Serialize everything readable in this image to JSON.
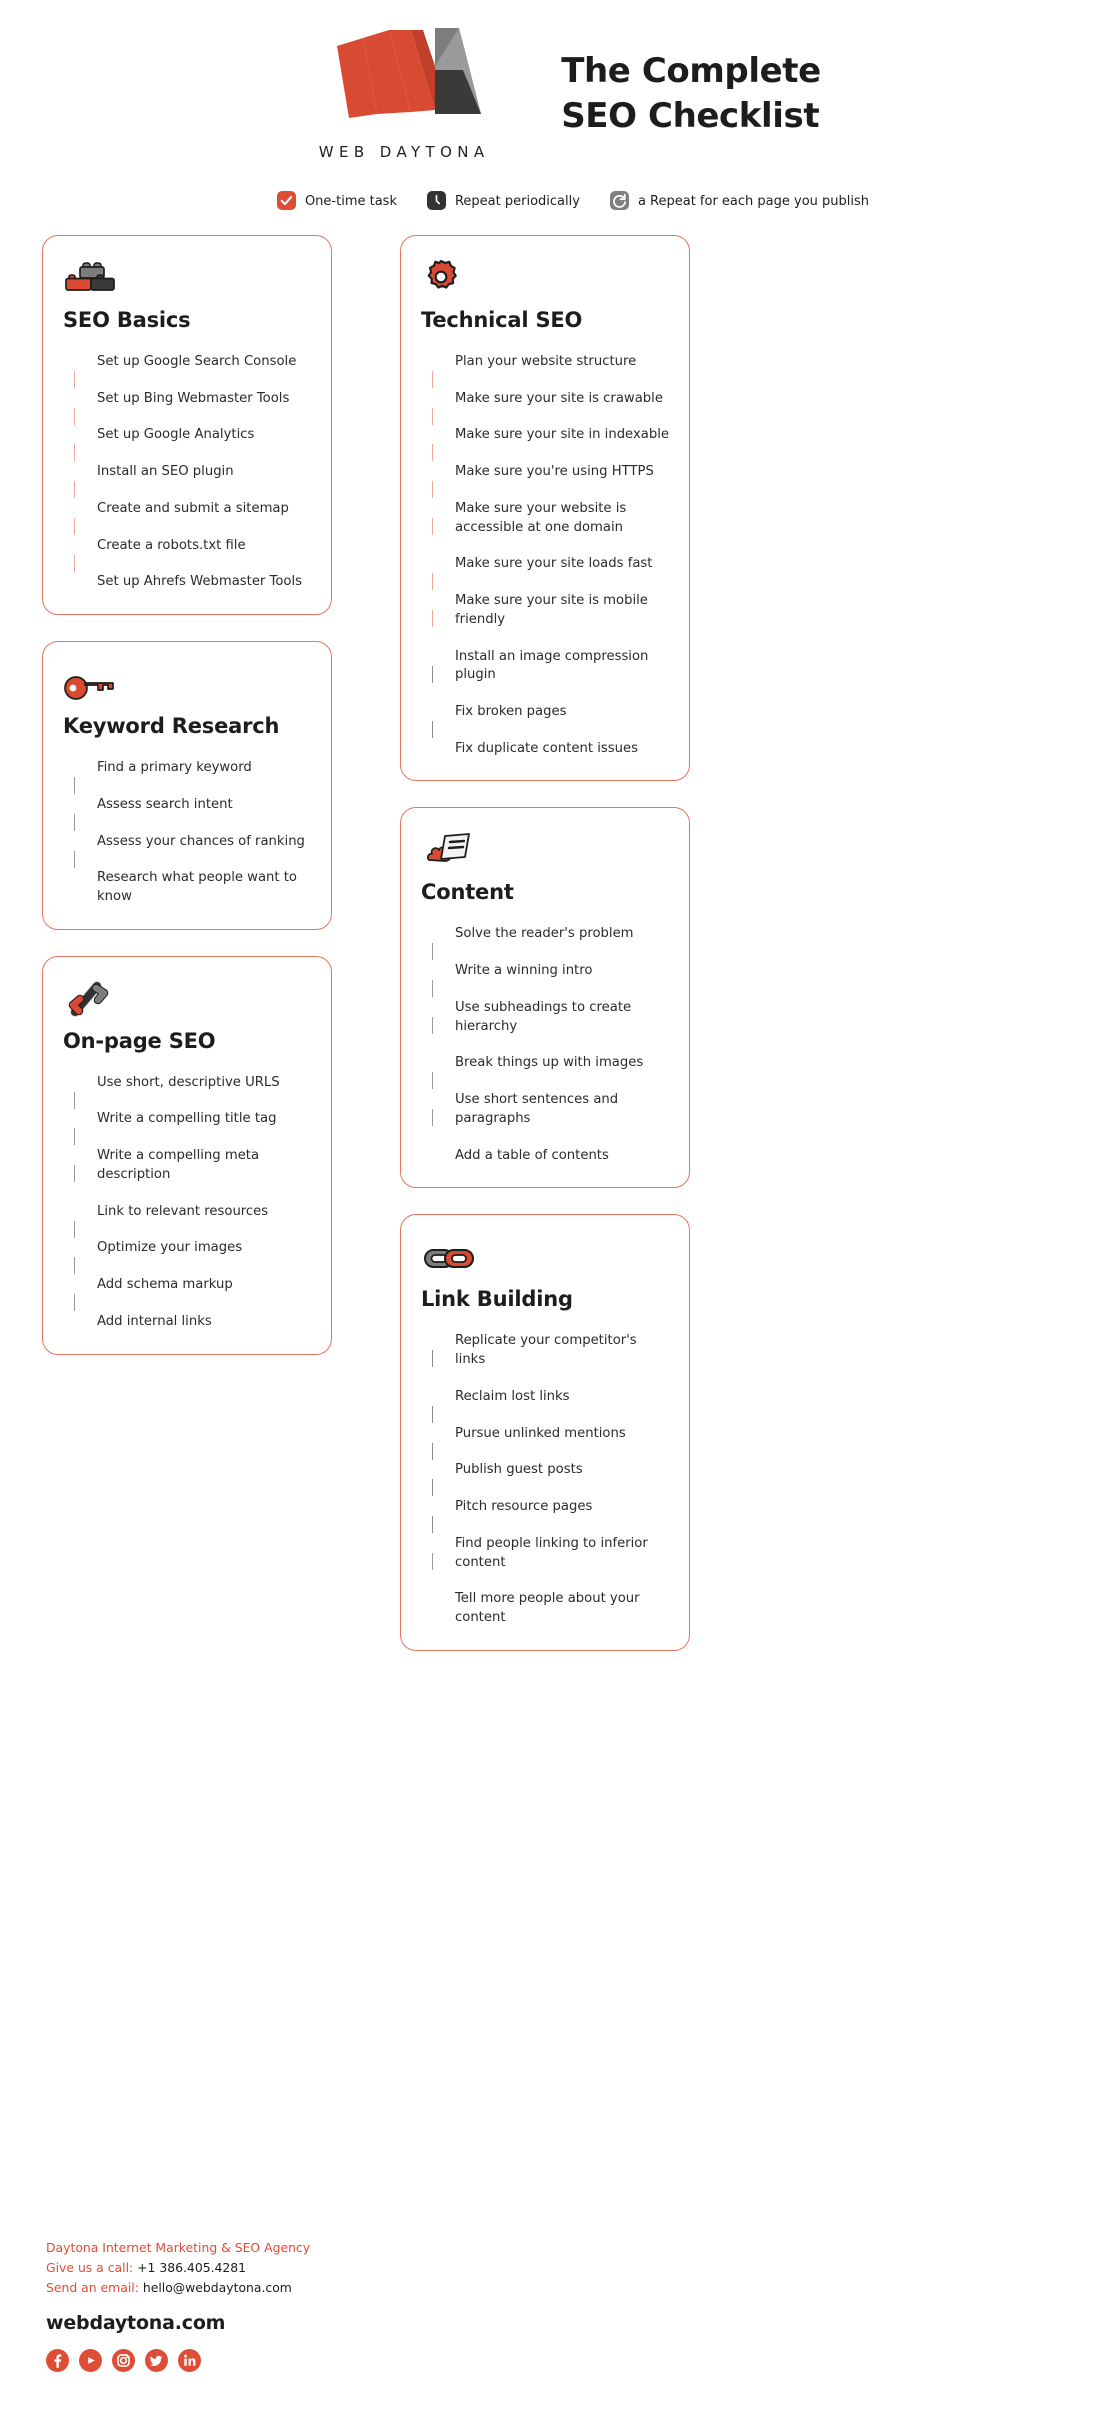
{
  "brand": {
    "logo_wordmark": "WEB DAYTONA",
    "logo_icon": "web-daytona-wa-logo"
  },
  "header": {
    "title_line_1": "The Complete",
    "title_line_2": "SEO Checklist"
  },
  "legend": [
    {
      "icon": "red-checkbox-icon",
      "type": "one-time",
      "label": "One-time task"
    },
    {
      "icon": "dark-clock-icon",
      "type": "periodic",
      "label": "Repeat periodically"
    },
    {
      "icon": "gray-refresh-icon",
      "type": "per-page",
      "label": "a Repeat for each page you publish"
    }
  ],
  "colors": {
    "accent_red": "#de4d36",
    "card_border": "#e8745c",
    "dark": "#333333",
    "gray": "#808080",
    "text": "#2b2b2b",
    "connector_red": "#efa99a",
    "connector_gray": "#9a9a9a"
  },
  "columns": {
    "left": [
      {
        "id": "seo-basics",
        "title": "SEO Basics",
        "icon": "lego-bricks-icon",
        "items": [
          {
            "marker": "one-time",
            "text": "Set up Google Search Console"
          },
          {
            "marker": "one-time",
            "text": "Set up Bing Webmaster Tools"
          },
          {
            "marker": "one-time",
            "text": "Set up Google Analytics"
          },
          {
            "marker": "one-time",
            "text": "Install an SEO plugin"
          },
          {
            "marker": "one-time",
            "text": "Create and submit a sitemap"
          },
          {
            "marker": "one-time",
            "text": "Create a robots.txt file"
          },
          {
            "marker": "one-time",
            "text": "Set up Ahrefs Webmaster Tools"
          }
        ]
      },
      {
        "id": "keyword-research",
        "title": "Keyword Research",
        "icon": "key-icon",
        "items": [
          {
            "marker": "per-page",
            "text": "Find a primary keyword"
          },
          {
            "marker": "per-page",
            "text": "Assess search intent"
          },
          {
            "marker": "per-page",
            "text": "Assess your chances of ranking"
          },
          {
            "marker": "per-page",
            "text": "Research what people want to know"
          }
        ]
      },
      {
        "id": "on-page-seo",
        "title": "On-page SEO",
        "icon": "code-slash-icon",
        "items": [
          {
            "marker": "per-page",
            "text": "Use short, descriptive URLS"
          },
          {
            "marker": "per-page",
            "text": "Write a compelling title tag"
          },
          {
            "marker": "per-page",
            "text": "Write a compelling meta description"
          },
          {
            "marker": "per-page",
            "text": "Link to relevant resources"
          },
          {
            "marker": "per-page",
            "text": "Optimize your images"
          },
          {
            "marker": "per-page",
            "text": "Add schema markup"
          },
          {
            "marker": "per-page",
            "text": "Add internal links"
          }
        ]
      }
    ],
    "right": [
      {
        "id": "technical-seo",
        "title": "Technical SEO",
        "icon": "gear-icon",
        "items": [
          {
            "marker": "one-time",
            "text": "Plan your website structure"
          },
          {
            "marker": "one-time",
            "text": "Make sure your site is crawable"
          },
          {
            "marker": "one-time",
            "text": "Make sure your site in indexable"
          },
          {
            "marker": "one-time",
            "text": "Make sure you're using HTTPS"
          },
          {
            "marker": "one-time",
            "text": "Make sure your website is accessible at one domain"
          },
          {
            "marker": "one-time",
            "text": "Make sure your site loads fast"
          },
          {
            "marker": "one-time",
            "text": "Make sure your site is mobile friendly"
          },
          {
            "marker": "one-time",
            "text": "Install an image compression plugin"
          },
          {
            "marker": "periodic",
            "text": "Fix broken pages"
          },
          {
            "marker": "periodic",
            "text": "Fix duplicate content issues"
          }
        ]
      },
      {
        "id": "content",
        "title": "Content",
        "icon": "burning-document-icon",
        "items": [
          {
            "marker": "per-page",
            "text": "Solve the reader's problem"
          },
          {
            "marker": "per-page",
            "text": "Write a winning intro"
          },
          {
            "marker": "per-page",
            "text": "Use subheadings to create hierarchy"
          },
          {
            "marker": "per-page",
            "text": "Break things up with images"
          },
          {
            "marker": "per-page",
            "text": "Use short sentences and paragraphs"
          },
          {
            "marker": "per-page",
            "text": "Add a table of contents"
          }
        ]
      },
      {
        "id": "link-building",
        "title": "Link Building",
        "icon": "chain-link-icon",
        "items": [
          {
            "marker": "periodic",
            "text": "Replicate your competitor's links"
          },
          {
            "marker": "periodic",
            "text": "Reclaim lost links"
          },
          {
            "marker": "periodic",
            "text": "Pursue unlinked mentions"
          },
          {
            "marker": "periodic",
            "text": "Publish guest posts"
          },
          {
            "marker": "periodic",
            "text": "Pitch resource pages"
          },
          {
            "marker": "per-page",
            "text": "Find people linking to inferior content"
          },
          {
            "marker": "per-page",
            "text": "Tell more people about your content"
          }
        ]
      }
    ]
  },
  "footer": {
    "agency": "Daytona Internet Marketing & SEO Agency",
    "phone_label": "Give us a call:",
    "phone_value": "+1 386.405.4281",
    "email_label": "Send an email:",
    "email_value": "hello@webdaytona.com",
    "website": "webdaytona.com",
    "socials": [
      {
        "name": "facebook-icon"
      },
      {
        "name": "youtube-icon"
      },
      {
        "name": "instagram-icon"
      },
      {
        "name": "twitter-icon"
      },
      {
        "name": "linkedin-icon"
      }
    ]
  }
}
